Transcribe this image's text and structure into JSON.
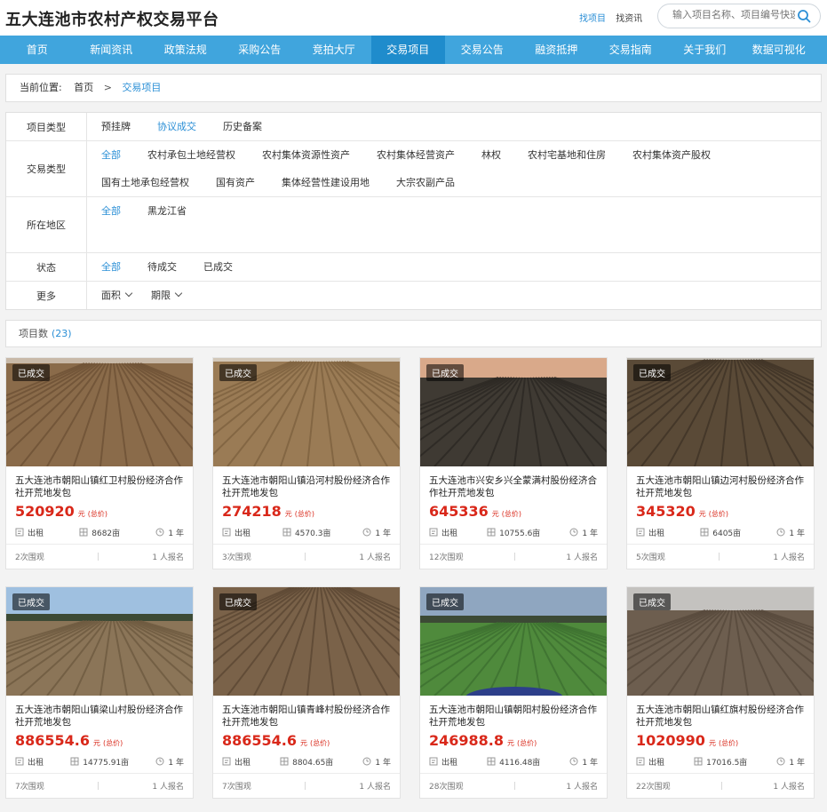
{
  "site": {
    "title": "五大连池市农村产权交易平台",
    "link_project": "找项目",
    "link_capital": "找资讯",
    "search_placeholder": "输入项目名称、项目编号快速"
  },
  "nav": [
    "首页",
    "新闻资讯",
    "政策法规",
    "采购公告",
    "竞拍大厅",
    "交易项目",
    "交易公告",
    "融资抵押",
    "交易指南",
    "关于我们",
    "数据可视化"
  ],
  "nav_active": 5,
  "breadcrumb": {
    "prefix": "当前位置:",
    "home": "首页",
    "sep": ">",
    "current": "交易项目"
  },
  "filters": {
    "project_type": {
      "label": "项目类型",
      "options": [
        "预挂牌",
        "协议成交",
        "历史备案"
      ],
      "selected": 1
    },
    "trade_type": {
      "label": "交易类型",
      "options": [
        "全部",
        "农村承包土地经营权",
        "农村集体资源性资产",
        "农村集体经营资产",
        "林权",
        "农村宅基地和住房",
        "农村集体资产股权",
        "国有土地承包经营权",
        "国有资产",
        "集体经营性建设用地",
        "大宗农副产品"
      ],
      "selected": 0
    },
    "region": {
      "label": "所在地区",
      "options": [
        "全部",
        "黑龙江省"
      ],
      "selected": 0
    },
    "status": {
      "label": "状态",
      "options": [
        "全部",
        "待成交",
        "已成交"
      ],
      "selected": 0
    },
    "more": {
      "label": "更多",
      "area": "面积",
      "term": "期限"
    }
  },
  "count": {
    "label": "项目数",
    "value": "(23)"
  },
  "cards": [
    {
      "badge": "已成交",
      "title": "五大连池市朝阳山镇红卫村股份经济合作社开荒地发包",
      "price": "520920",
      "unit": "元",
      "price_label": "(总价)",
      "mode": "出租",
      "area": "8682亩",
      "term": "1 年",
      "views": "2次围观",
      "signups": "1 人报名"
    },
    {
      "badge": "已成交",
      "title": "五大连池市朝阳山镇沿河村股份经济合作社开荒地发包",
      "price": "274218",
      "unit": "元",
      "price_label": "(总价)",
      "mode": "出租",
      "area": "4570.3亩",
      "term": "1 年",
      "views": "3次围观",
      "signups": "1 人报名"
    },
    {
      "badge": "已成交",
      "title": "五大连池市兴安乡兴全蒙满村股份经济合作社开荒地发包",
      "price": "645336",
      "unit": "元",
      "price_label": "(总价)",
      "mode": "出租",
      "area": "10755.6亩",
      "term": "1 年",
      "views": "12次围观",
      "signups": "1 人报名"
    },
    {
      "badge": "已成交",
      "title": "五大连池市朝阳山镇边河村股份经济合作社开荒地发包",
      "price": "345320",
      "unit": "元",
      "price_label": "(总价)",
      "mode": "出租",
      "area": "6405亩",
      "term": "1 年",
      "views": "5次围观",
      "signups": "1 人报名"
    },
    {
      "badge": "已成交",
      "title": "五大连池市朝阳山镇梁山村股份经济合作社开荒地发包",
      "price": "886554.6",
      "unit": "元",
      "price_label": "(总价)",
      "mode": "出租",
      "area": "14775.91亩",
      "term": "1 年",
      "views": "7次围观",
      "signups": "1 人报名"
    },
    {
      "badge": "已成交",
      "title": "五大连池市朝阳山镇青峰村股份经济合作社开荒地发包",
      "price": "886554.6",
      "unit": "元",
      "price_label": "(总价)",
      "mode": "出租",
      "area": "8804.65亩",
      "term": "1 年",
      "views": "7次围观",
      "signups": "1 人报名"
    },
    {
      "badge": "已成交",
      "title": "五大连池市朝阳山镇朝阳村股份经济合作社开荒地发包",
      "price": "246988.8",
      "unit": "元",
      "price_label": "(总价)",
      "mode": "出租",
      "area": "4116.48亩",
      "term": "1 年",
      "views": "28次围观",
      "signups": "1 人报名"
    },
    {
      "badge": "已成交",
      "title": "五大连池市朝阳山镇红旗村股份经济合作社开荒地发包",
      "price": "1020990",
      "unit": "元",
      "price_label": "(总价)",
      "mode": "出租",
      "area": "17016.5亩",
      "term": "1 年",
      "views": "22次围观",
      "signups": "1 人报名"
    }
  ],
  "colors": {
    "nav": "#40a5dd",
    "nav_active": "#1f8ccc",
    "accent": "#2b8fd6",
    "price": "#d9281a"
  },
  "icons": {
    "search": "search-icon",
    "mode": "lease-icon",
    "area": "area-icon",
    "term": "clock-icon"
  }
}
